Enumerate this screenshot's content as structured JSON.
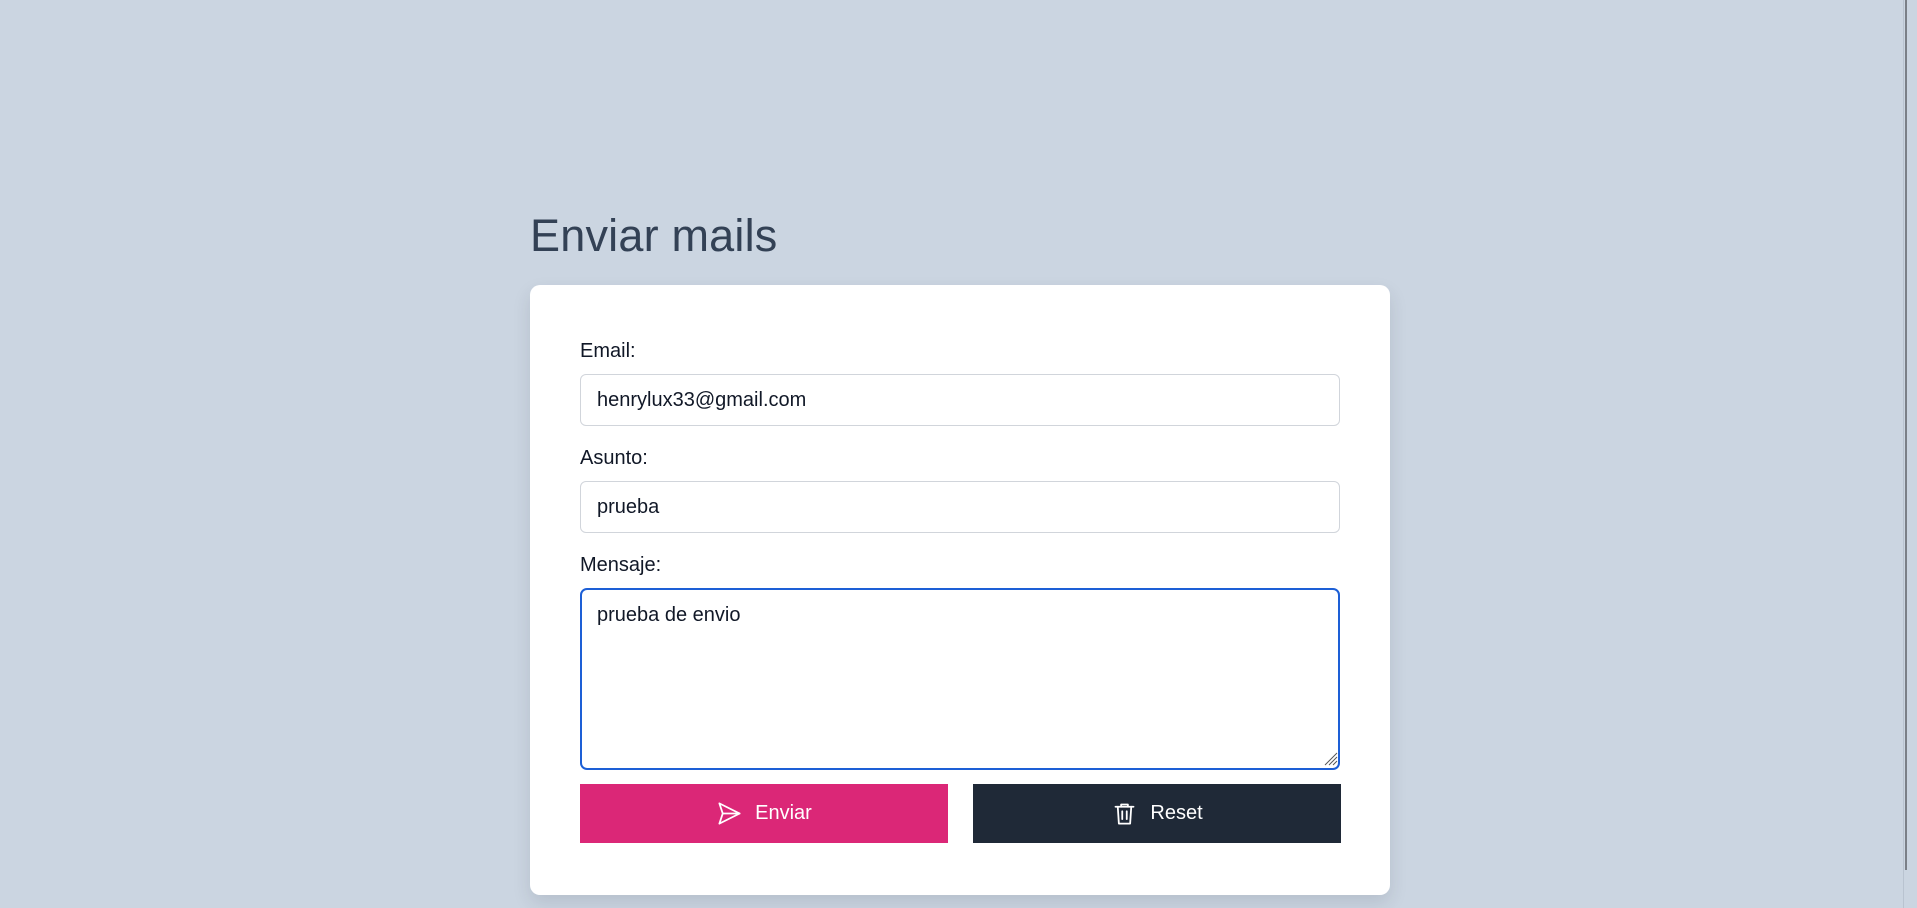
{
  "page": {
    "title": "Enviar mails"
  },
  "form": {
    "email_label": "Email:",
    "email_value": "henrylux33@gmail.com",
    "subject_label": "Asunto:",
    "subject_value": "prueba",
    "message_label": "Mensaje:",
    "message_value": "prueba de envio",
    "send_label": "Enviar",
    "reset_label": "Reset",
    "send_icon": "send-icon",
    "reset_icon": "trash-icon"
  },
  "colors": {
    "background": "#cbd5e1",
    "title": "#334155",
    "send_button": "#db2777",
    "reset_button": "#1f2937",
    "focus_border": "#1d5fd6"
  }
}
